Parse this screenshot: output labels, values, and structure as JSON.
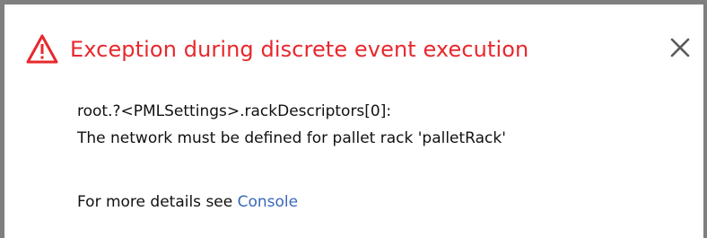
{
  "dialog": {
    "title": "Exception during discrete event execution",
    "icons": {
      "warning": "warning-triangle-icon",
      "close": "close-icon"
    },
    "message_line1": "root.?<PMLSettings>.rackDescriptors[0]:",
    "message_line2": "The network must be defined for pallet rack 'palletRack'",
    "details_prefix": "For more details see ",
    "details_link": "Console"
  },
  "colors": {
    "title": "#e8282d",
    "link": "#3a68b8",
    "border": "#7f7f7f"
  }
}
